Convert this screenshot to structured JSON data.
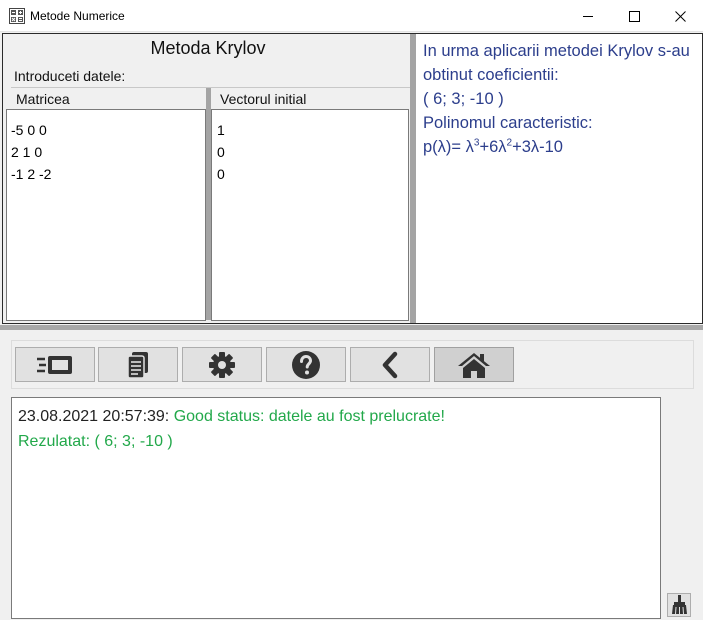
{
  "window": {
    "title": "Metode Numerice",
    "icon": "calculator-icon",
    "controls": [
      "minimize-icon",
      "maximize-icon",
      "close-icon"
    ]
  },
  "krylov": {
    "title": "Metoda Krylov",
    "input_caption": "Introduceti datele:",
    "matrix_label": "Matricea",
    "vector_label": "Vectorul initial",
    "matrix_lines": [
      "-5 0 0",
      "2 1 0",
      "-1 2 -2"
    ],
    "vector_lines": [
      "1",
      "0",
      "0"
    ]
  },
  "result": {
    "intro": "In urma aplicarii metodei Krylov s-au obtinut coeficientii:",
    "coefficients": "( 6; 3; -10 )",
    "poly_label": "Polinomul caracteristic:",
    "poly_prefix": "p(λ)= λ",
    "poly_exp1": "3",
    "poly_mid": "+6λ",
    "poly_exp2": "2",
    "poly_suffix": "+3λ-10"
  },
  "toolbar": {
    "buttons": [
      {
        "name": "run-method-button",
        "icon": "fast-card-icon"
      },
      {
        "name": "documentation-button",
        "icon": "document-icon"
      },
      {
        "name": "settings-button",
        "icon": "gear-icon"
      },
      {
        "name": "help-button",
        "icon": "question-icon"
      },
      {
        "name": "back-button",
        "icon": "chevron-left-icon"
      },
      {
        "name": "home-button",
        "icon": "home-icon",
        "active": true
      }
    ]
  },
  "log": {
    "entries": [
      {
        "timestamp": "23.08.2021 20:57:39:",
        "message": " Good status: datele au fost prelucrate!"
      },
      {
        "timestamp": "",
        "message": "Rezulatat: ( 6; 3; -10 )"
      }
    ],
    "clear_icon": "broom-icon"
  },
  "colors": {
    "result_text": "#2c3e8c",
    "log_success": "#22a84a",
    "icon": "#333333"
  }
}
